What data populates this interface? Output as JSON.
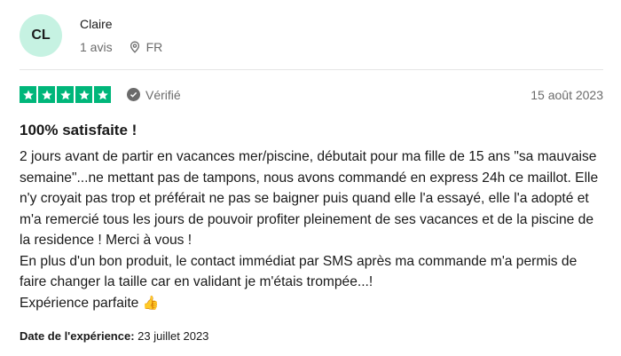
{
  "reviewer": {
    "initials": "CL",
    "name": "Claire",
    "review_count": "1 avis",
    "country": "FR",
    "avatar_color": "#c6f2e2"
  },
  "rating": {
    "stars": 5,
    "star_color": "#00b67a",
    "verified_label": "Vérifié",
    "date": "15 août 2023"
  },
  "review": {
    "title": "100% satisfaite !",
    "paragraphs": [
      "2 jours avant de partir en vacances mer/piscine, débutait pour ma fille de 15 ans \"sa mauvaise semaine\"...ne mettant pas de tampons, nous avons commandé en express 24h ce maillot. Elle n'y croyait pas trop et préférait ne pas se baigner puis quand elle l'a essayé, elle l'a adopté et m'a remercié tous les jours de pouvoir profiter pleinement de ses vacances et de la piscine de la residence ! Merci à vous !",
      "En plus d'un bon produit, le contact immédiat par SMS après ma commande m'a permis de faire changer la taille car en validant je m'étais trompée...!"
    ],
    "closing": "Expérience parfaite",
    "closing_emoji": "👍"
  },
  "experience": {
    "label": "Date de l'expérience:",
    "date": "23 juillet 2023"
  }
}
